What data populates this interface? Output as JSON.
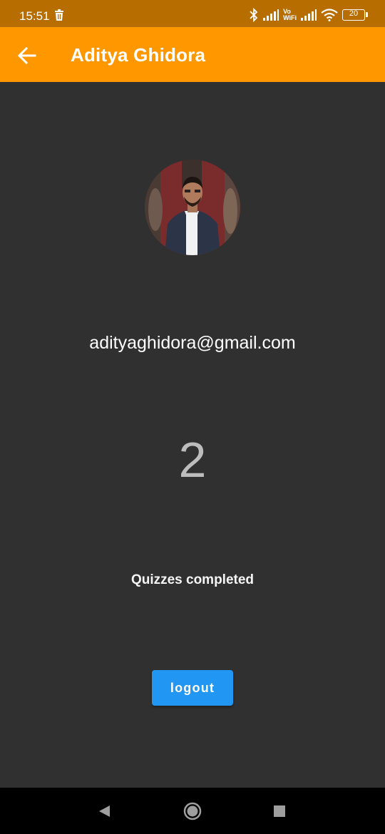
{
  "status_bar": {
    "time": "15:51",
    "network_label_top": "Vo",
    "network_label_bottom": "WiFi",
    "battery": "20"
  },
  "app_bar": {
    "title": "Aditya Ghidora",
    "color": "#ff9800"
  },
  "profile": {
    "email": "adityaghidora@gmail.com",
    "quizzes_count": "2",
    "quizzes_label": "Quizzes completed"
  },
  "actions": {
    "logout_label": "logout",
    "logout_color": "#2196f3"
  },
  "icons": {
    "back": "arrow-left-icon",
    "status_left": "trash-icon",
    "bluetooth": "bluetooth-icon",
    "signal": "signal-icon",
    "wifi": "wifi-icon",
    "battery": "battery-icon",
    "nav_back": "triangle-back-icon",
    "nav_home": "circle-home-icon",
    "nav_recents": "square-recents-icon"
  }
}
